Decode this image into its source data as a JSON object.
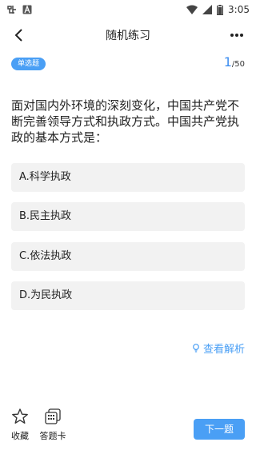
{
  "status": {
    "time": "3:05"
  },
  "appbar": {
    "title": "随机练习"
  },
  "question": {
    "type_badge": "单选题",
    "current": "1",
    "total": "/50",
    "text": "面对国内外环境的深刻变化，中国共产党不断完善领导方式和执政方式。中国共产党执政的基本方式是：",
    "options": [
      {
        "label": "A.科学执政"
      },
      {
        "label": "B.民主执政"
      },
      {
        "label": "C.依法执政"
      },
      {
        "label": "D.为民执政"
      }
    ]
  },
  "explain_label": "查看解析",
  "bottom": {
    "favorite_label": "收藏",
    "answer_card_label": "答题卡",
    "next_label": "下一题"
  },
  "colors": {
    "accent": "#4a9ff5",
    "option_bg": "#f2f2f2"
  }
}
